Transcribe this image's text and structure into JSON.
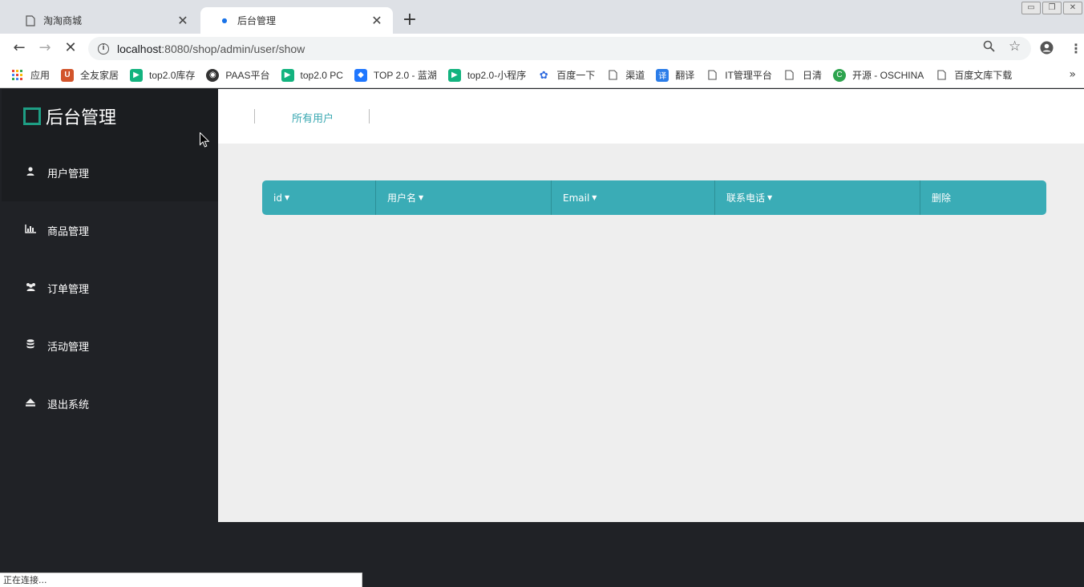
{
  "browser": {
    "tabs": [
      {
        "title": "淘淘商城",
        "active": false
      },
      {
        "title": "后台管理",
        "active": true
      }
    ],
    "url_host": "localhost",
    "url_rest": ":8080/shop/admin/user/show",
    "bookmarks": [
      {
        "label": "应用",
        "icon": "apps-grid-icon",
        "color": "#ea4335"
      },
      {
        "label": "全友家居",
        "icon": "brand-u-icon",
        "color": "#d2542b"
      },
      {
        "label": "top2.0库存",
        "icon": "play-icon",
        "color": "#13b37f"
      },
      {
        "label": "PAAS平台",
        "icon": "globe-icon",
        "color": "#333333"
      },
      {
        "label": "top2.0 PC",
        "icon": "play-icon",
        "color": "#13b37f"
      },
      {
        "label": "TOP 2.0 - 蓝湖",
        "icon": "lanhu-icon",
        "color": "#1f77ff"
      },
      {
        "label": "top2.0-小程序",
        "icon": "play-icon",
        "color": "#13b37f"
      },
      {
        "label": "百度一下",
        "icon": "paw-icon",
        "color": "#2f6bdf"
      },
      {
        "label": "渠道",
        "icon": "page-icon",
        "color": "#666666"
      },
      {
        "label": "翻译",
        "icon": "translate-icon",
        "color": "#2b7de9"
      },
      {
        "label": "IT管理平台",
        "icon": "page-icon",
        "color": "#666666"
      },
      {
        "label": "日清",
        "icon": "page-icon",
        "color": "#666666"
      },
      {
        "label": "开源 - OSCHINA",
        "icon": "oschina-icon",
        "color": "#2ea44f"
      },
      {
        "label": "百度文库下载",
        "icon": "page-icon",
        "color": "#666666"
      }
    ],
    "status_text": "正在连接..."
  },
  "sidebar": {
    "brand": "后台管理",
    "items": [
      {
        "label": "用户管理",
        "icon": "user-icon"
      },
      {
        "label": "商品管理",
        "icon": "bar-chart-icon"
      },
      {
        "label": "订单管理",
        "icon": "users-icon"
      },
      {
        "label": "活动管理",
        "icon": "database-icon"
      },
      {
        "label": "退出系统",
        "icon": "eject-icon"
      }
    ]
  },
  "content": {
    "top_link": "所有用户",
    "columns": [
      "id",
      "用户名",
      "Email",
      "联系电话",
      "删除"
    ],
    "accent": "#3aacb6"
  }
}
